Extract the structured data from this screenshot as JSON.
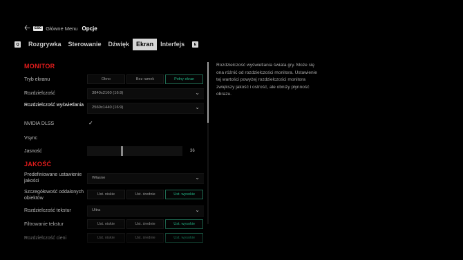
{
  "topbar": {
    "key": "ESC",
    "main_menu": "Główne Menu",
    "current": "Opcje"
  },
  "tabs": {
    "left_key": "Q",
    "right_key": "E",
    "items": [
      "Rozgrywka",
      "Sterowanie",
      "Dźwięk",
      "Ekran",
      "Interfejs"
    ],
    "active": "Ekran"
  },
  "monitor": {
    "title": "MONITOR",
    "screen_mode": {
      "label": "Tryb ekranu",
      "options": [
        "Okno",
        "Bez ramek",
        "Pełny ekran"
      ],
      "selected": "Pełny ekran"
    },
    "resolution": {
      "label": "Rozdzielczość",
      "value": "3840x2160 (16:9)"
    },
    "display_resolution": {
      "label": "Rozdzielczość wyświetlania",
      "value": "2560x1440 (16:9)"
    },
    "dlss": {
      "label": "NVIDIA DLSS",
      "checked": true,
      "check_glyph": "✓"
    },
    "vsync": {
      "label": "Vsync",
      "checked": false
    },
    "brightness": {
      "label": "Jasność",
      "value": "36",
      "level": 0.36
    }
  },
  "quality": {
    "title": "JAKOŚĆ",
    "preset": {
      "label": "Predefiniowane ustawienie jakości",
      "value": "Własne"
    },
    "distant_detail": {
      "label": "Szczegółowość oddalonych obiektów",
      "options": [
        "Ust. niskie",
        "Ust. średnie",
        "Ust. wysokie"
      ],
      "selected": "Ust. wysokie"
    },
    "texture_res": {
      "label": "Rozdzielczość tekstur",
      "value": "Ultra"
    },
    "texture_filter": {
      "label": "Filtrowanie tekstur",
      "options": [
        "Ust. niskie",
        "Ust. średnie",
        "Ust. wysokie"
      ],
      "selected": "Ust. wysokie"
    },
    "shadow_res": {
      "label": "Rozdzielczość cieni",
      "options": [
        "Ust. niskie",
        "Ust. średnie",
        "Ust. wysokie"
      ],
      "selected": "Ust. wysokie"
    }
  },
  "description": "Rozdzielczość wyświetlania świata gry. Może się ona różnić od rozdzielczości monitora. Ustawienie tej wartości powyżej rozdzielczości monitora zwiększy jakość i ostrość, ale obniży płynność obrazu.",
  "icons": {
    "back": "arrow-left-icon",
    "dropdown": "chevron-down-icon",
    "check": "checkmark-icon"
  },
  "colors": {
    "accent_red": "#e21c1c",
    "selected_green": "#22b888"
  }
}
